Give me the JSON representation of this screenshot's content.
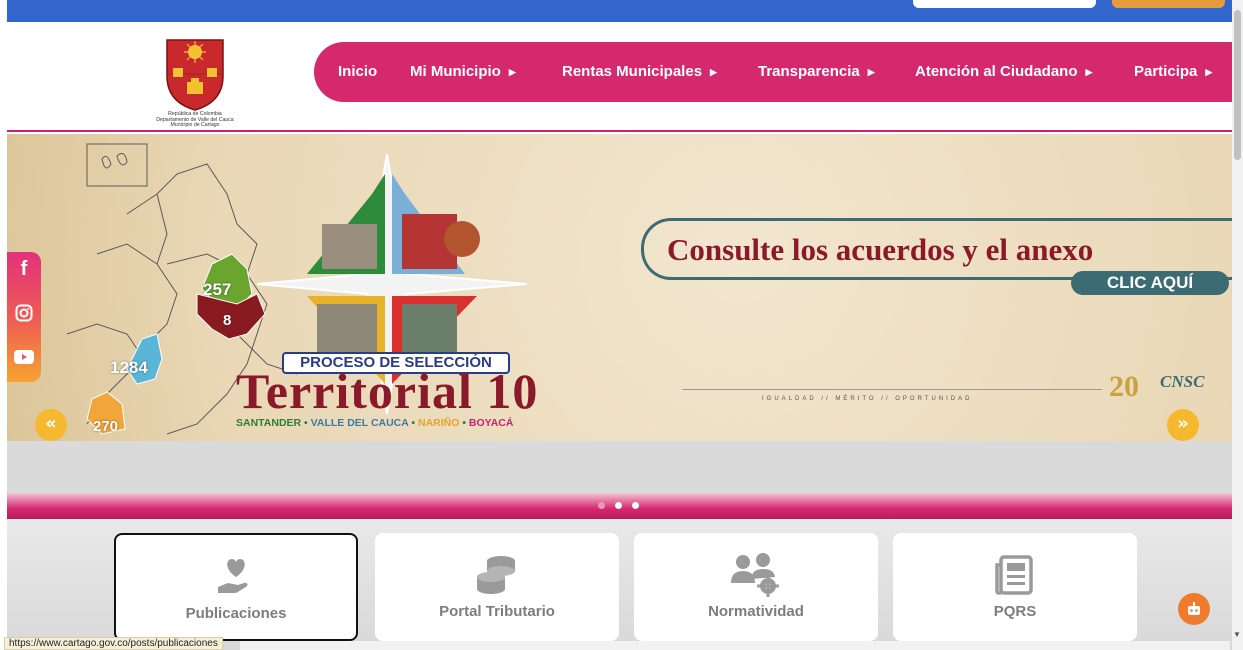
{
  "logo": {
    "caption_lines": [
      "República de Colombia",
      "Departamento de Valle del Cauca",
      "Municipio de Cartago"
    ]
  },
  "nav": {
    "items": [
      {
        "label": "Inicio",
        "has_caret": false
      },
      {
        "label": "Mi Municipio",
        "has_caret": true
      },
      {
        "label": "Rentas Municipales",
        "has_caret": true
      },
      {
        "label": "Transparencia",
        "has_caret": true
      },
      {
        "label": "Atención al Ciudadano",
        "has_caret": true
      },
      {
        "label": "Participa",
        "has_caret": true
      }
    ],
    "caret": "▶"
  },
  "banner": {
    "headline": "Consulte los acuerdos y el anexo",
    "cta": "CLIC AQUÍ",
    "proceso": "PROCESO DE SELECCIÓN",
    "territorial": "Territorial 10",
    "departments": [
      "SANTANDER",
      "VALLE DEL CAUCA",
      "NARIÑO",
      "BOYACÁ"
    ],
    "department_separator": " • ",
    "lema": "IGUALDAD // MÉRITO // OPORTUNIDAD",
    "cnsc_logo_text": "CNSC",
    "cnsc_anniversary": "20",
    "map_numbers": [
      "257",
      "8",
      "1284",
      "270"
    ],
    "prev_arrow": "«",
    "next_arrow": "»"
  },
  "social": {
    "items": [
      {
        "icon": "facebook-icon",
        "label": "f"
      },
      {
        "icon": "instagram-icon",
        "label": ""
      },
      {
        "icon": "youtube-icon",
        "label": ""
      }
    ]
  },
  "carousel": {
    "slide_count": 3,
    "active_index": 0
  },
  "cards": [
    {
      "label": "Publicaciones",
      "icon": "heart-hand-icon",
      "selected": true
    },
    {
      "label": "Portal Tributario",
      "icon": "coins-icon",
      "selected": false
    },
    {
      "label": "Normatividad",
      "icon": "users-gear-icon",
      "selected": false
    },
    {
      "label": "PQRS",
      "icon": "newspaper-icon",
      "selected": false
    }
  ],
  "statusbar": {
    "url": "https://www.cartago.gov.co/posts/publicaciones"
  },
  "colors": {
    "brand_pink": "#d6286f",
    "brand_blue": "#3366cc",
    "accent_yellow": "#f5b82e",
    "banner_maroon": "#8a1a2a",
    "banner_teal": "#3d6b73"
  }
}
